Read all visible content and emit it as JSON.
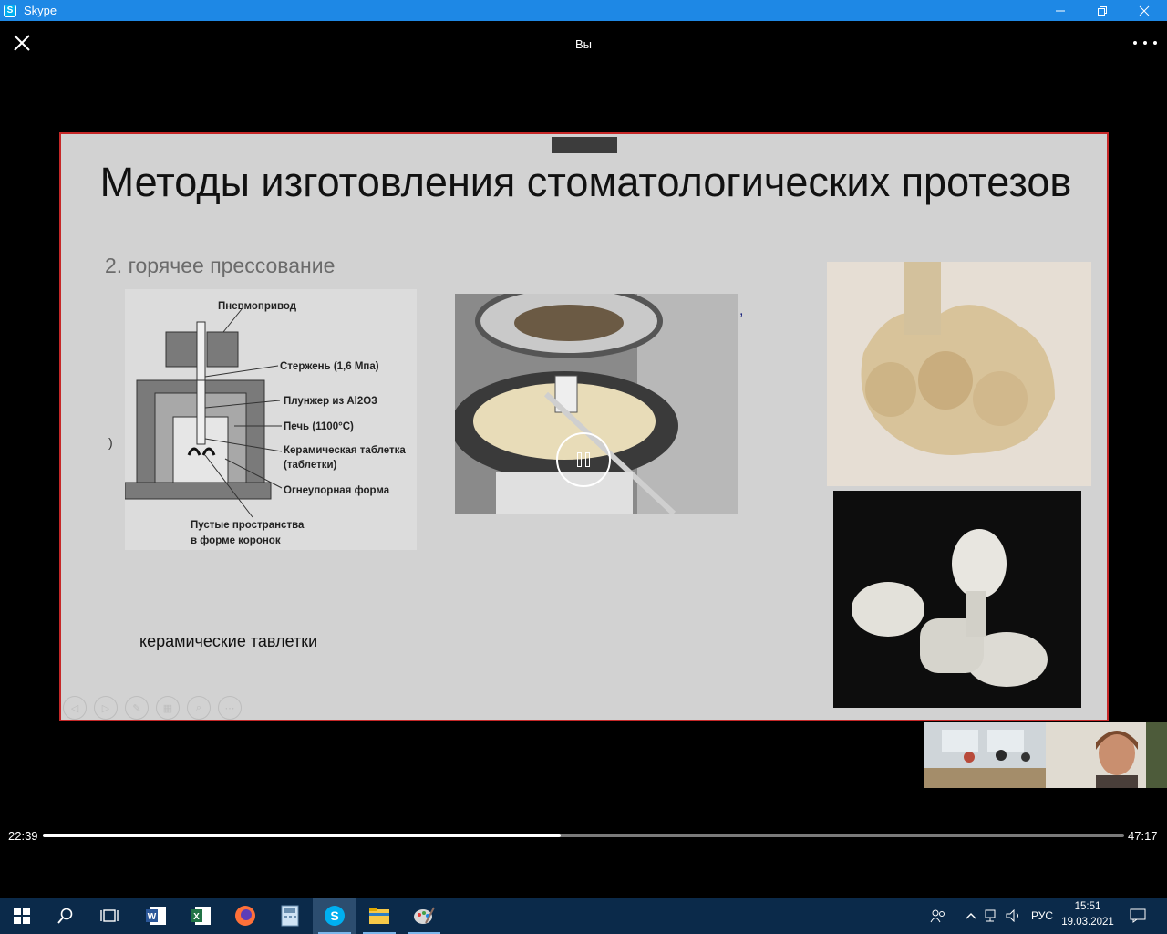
{
  "window": {
    "app_title": "Skype",
    "app_icon_letter": "S"
  },
  "header": {
    "title": "Вы"
  },
  "slide": {
    "title": "Методы изготовления стоматологических протезов",
    "subtitle": "2. горячее прессование",
    "caption": "керамические тавлетки",
    "diagram_labels": {
      "actuator": "Пневмопривод",
      "rod": "Стержень (1,6 Мпа)",
      "plunger": "Плунжер из Al2O3",
      "furnace": "Печь (1100°С)",
      "tablet_1": "Керамическая таблетка",
      "tablet_2": "(таблетки)",
      "mold": "Огнеупорная форма",
      "cavities_1": "Пустые пространства",
      "cavities_2": "в форме коронок"
    }
  },
  "player": {
    "elapsed": "22:39",
    "total": "47:17",
    "progress": 0.479
  },
  "taskbar": {
    "apps": [
      "start-icon",
      "search-icon",
      "task-view-icon",
      "word-icon",
      "excel-icon",
      "firefox-icon",
      "calculator-icon",
      "skype-icon",
      "file-explorer-icon",
      "paint-icon"
    ],
    "language": "РУС",
    "time": "15:51",
    "date": "19.03.2021"
  },
  "colors": {
    "titlebar": "#1e88e5",
    "taskbar": "#0b2a4a",
    "slide_border": "#c62828"
  }
}
